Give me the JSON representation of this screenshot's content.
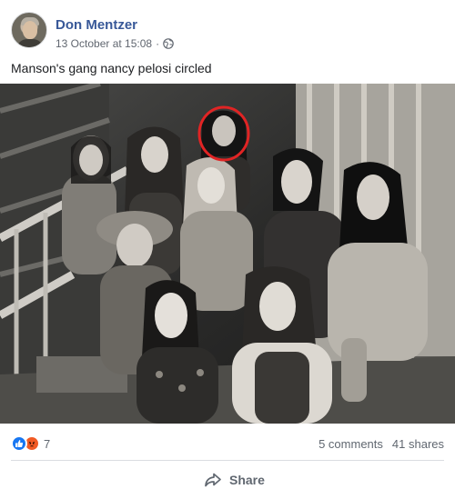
{
  "post": {
    "author": "Don Mentzer",
    "timestamp": "13 October at 15:08",
    "separator": "·",
    "privacy_icon": "globe-icon",
    "text": "Manson's gang nancy pelosi circled"
  },
  "reactions": {
    "icons": [
      "like-icon",
      "angry-icon"
    ],
    "count": "7"
  },
  "stats": {
    "comments": "5 comments",
    "shares": "41 shares"
  },
  "actions": {
    "share_label": "Share",
    "share_icon": "share-arrow-icon"
  },
  "colors": {
    "author": "#385898",
    "like": "#1877f2",
    "angry": "#f15a24",
    "highlight_circle": "#e02424"
  }
}
